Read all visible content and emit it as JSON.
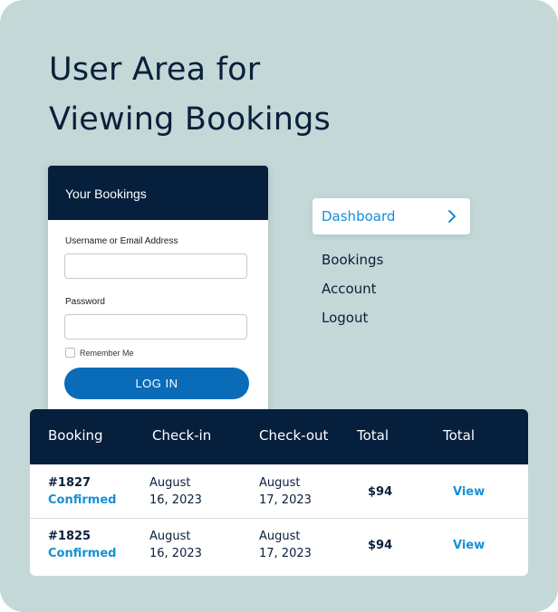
{
  "headline": {
    "line1": "User Area for",
    "line2": "Viewing Bookings"
  },
  "login": {
    "title": "Your Bookings",
    "username_label": "Username or Email Address",
    "username_value": "",
    "password_label": "Password",
    "password_value": "",
    "remember_label": "Remember Me",
    "login_button": "LOG IN"
  },
  "menu": {
    "active": "Dashboard",
    "items": [
      "Bookings",
      "Account",
      "Logout"
    ]
  },
  "table": {
    "headers": [
      "Booking",
      "Check-in",
      "Check-out",
      "Total",
      "Total"
    ],
    "rows": [
      {
        "id": "#1827",
        "status": "Confirmed",
        "checkin_line1": "August",
        "checkin_line2": "16, 2023",
        "checkout_line1": "August",
        "checkout_line2": "17, 2023",
        "total": "$94",
        "action": "View"
      },
      {
        "id": "#1825",
        "status": "Confirmed",
        "checkin_line1": "August",
        "checkin_line2": "16, 2023",
        "checkout_line1": "August",
        "checkout_line2": "17, 2023",
        "total": "$94",
        "action": "View"
      }
    ]
  },
  "colors": {
    "background": "#c4d8d8",
    "navy": "#061f3c",
    "accent_blue": "#1590d6",
    "button_blue": "#0a6bb8"
  },
  "icons": {
    "menu_chevron": "chevron-right-icon"
  }
}
